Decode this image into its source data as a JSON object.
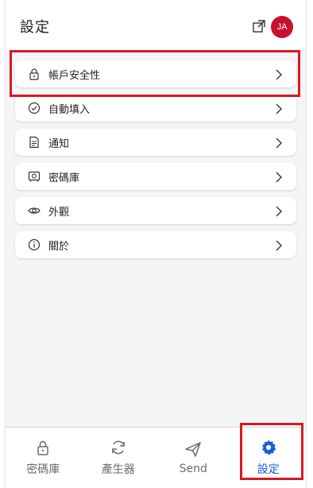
{
  "header": {
    "title": "設定",
    "avatar_initials": "JA",
    "avatar_color": "#c8102e",
    "popout_icon": "popout-icon"
  },
  "settings": {
    "items": [
      {
        "label": "帳戶安全性",
        "icon": "lock-icon"
      },
      {
        "label": "自動填入",
        "icon": "check-circle-icon"
      },
      {
        "label": "通知",
        "icon": "document-icon"
      },
      {
        "label": "密碼庫",
        "icon": "vault-icon"
      },
      {
        "label": "外觀",
        "icon": "eye-icon"
      },
      {
        "label": "關於",
        "icon": "info-icon"
      }
    ]
  },
  "bottom_nav": {
    "items": [
      {
        "label": "密碼庫",
        "icon": "lock-icon",
        "active": false
      },
      {
        "label": "產生器",
        "icon": "refresh-icon",
        "active": false
      },
      {
        "label": "Send",
        "icon": "send-icon",
        "active": false
      },
      {
        "label": "設定",
        "icon": "gear-icon",
        "active": true
      }
    ]
  },
  "colors": {
    "accent": "#175ddc",
    "highlight_box": "#d71921",
    "content_bg": "#f3f5f7"
  }
}
